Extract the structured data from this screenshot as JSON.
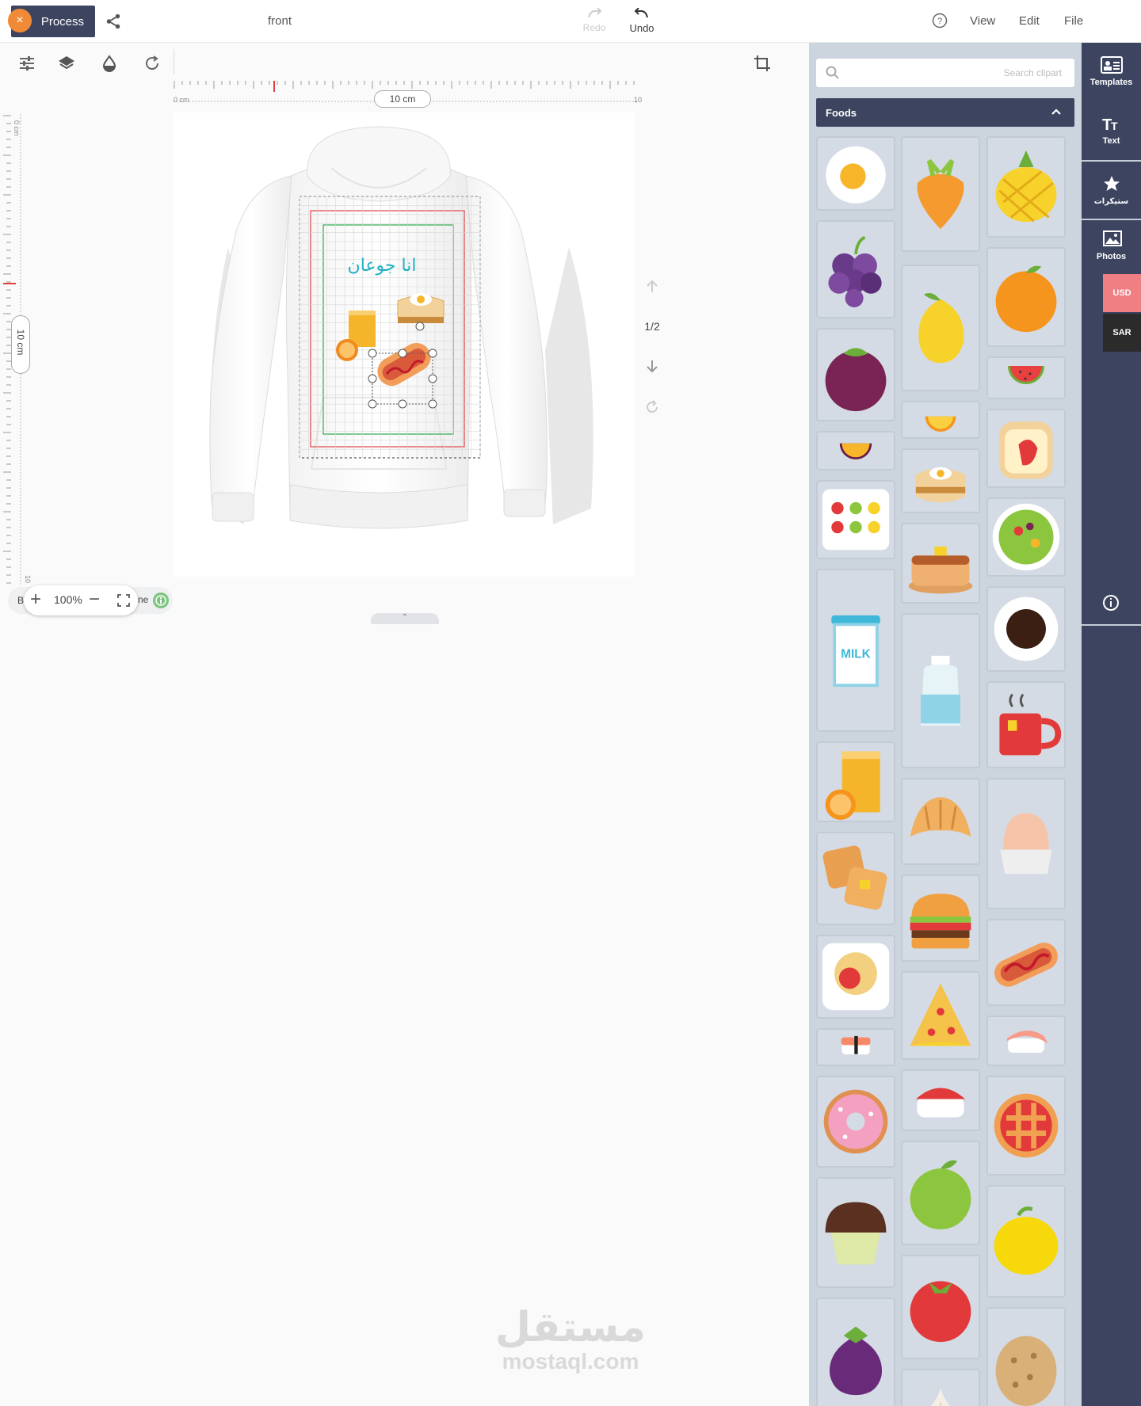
{
  "topbar": {
    "process_label": "Process",
    "close_glyph": "×",
    "side_name": "front",
    "redo_label": "Redo",
    "undo_label": "Undo",
    "menu": [
      "View",
      "Edit",
      "File"
    ]
  },
  "rulers": {
    "h_start": "0 cm",
    "h_mid": "10 cm",
    "h_end": "10",
    "v_start": "0 cm",
    "v_mid": "10 cm",
    "v_end": "10"
  },
  "design": {
    "arabic_text": "انا جوعان",
    "page_indicator": "1/2"
  },
  "zoom": {
    "value": "100%",
    "left_fragment": "B",
    "right_fragment": "ne"
  },
  "clipart": {
    "search_placeholder": "Search clipart",
    "category": "Foods"
  },
  "rail": {
    "templates": "Templates",
    "text": "Text",
    "stickers": "ستيكرات",
    "photos": "Photos",
    "currency_usd": "USD",
    "currency_sar": "SAR"
  },
  "watermark": {
    "arabic": "مستقل",
    "latin": "mostaql.com"
  },
  "colors": {
    "primary": "#3d4460",
    "accent_orange": "#f08a36",
    "usd": "#f07f84",
    "sar": "#2b2b2b",
    "panel_bg": "#ccd4de",
    "arabic_text": "#1fb1c4"
  },
  "clip_icons": [
    "egg-icon",
    "carrot-icon",
    "pineapple-icon",
    "grapes-icon",
    "mango-icon",
    "orange-icon",
    "mangosteen-icon",
    "lemon-slice-icon",
    "watermelon-icon",
    "passion-fruit-icon",
    "egg-sandwich-icon",
    "toast-strawberry-icon",
    "fruit-box-icon",
    "pancakes-icon",
    "salad-icon",
    "milk-icon",
    "water-bottle-icon",
    "coffee-icon",
    "orange-juice-icon",
    "croissant-icon",
    "tea-cup-icon",
    "waffles-icon",
    "burger-icon",
    "boiled-egg-icon",
    "spaghetti-icon",
    "pizza-icon",
    "hotdog-icon",
    "sushi-salmon-icon",
    "sushi-tuna-icon",
    "sushi-shrimp-icon",
    "donut-icon",
    "green-apple-icon",
    "pie-icon",
    "muffin-icon",
    "tomato-icon",
    "lemon-icon",
    "eggplant-icon",
    "garlic-icon",
    "potato-icon"
  ]
}
